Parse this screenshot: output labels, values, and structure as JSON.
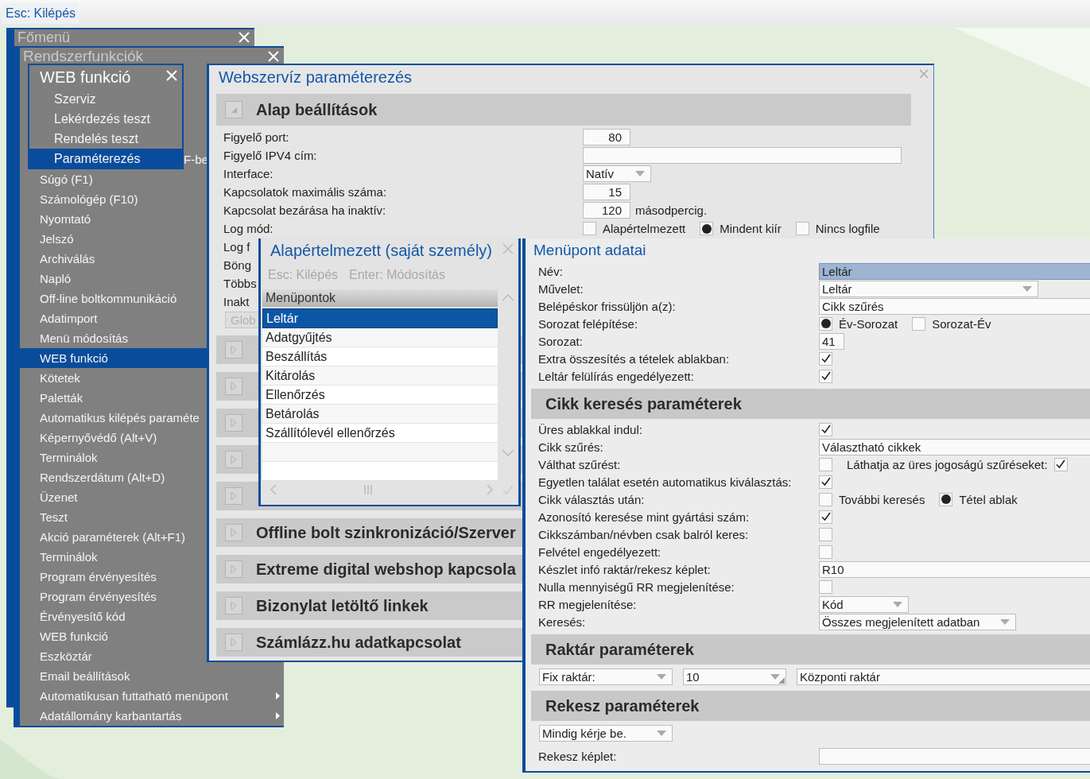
{
  "top_bar": {
    "hint": "Esc: Kilépés"
  },
  "main_menu": {
    "title": "Főmenü"
  },
  "system_functions": {
    "title": "Rendszerfunkciók",
    "items": [
      {
        "label": "F-be",
        "kind": "cut",
        "selected": false,
        "submenu": false
      },
      {
        "label": "Súgó (F1)",
        "kind": "item",
        "selected": false,
        "submenu": false
      },
      {
        "label": "Számológép (F10)",
        "kind": "item",
        "selected": false,
        "submenu": false
      },
      {
        "label": "Nyomtató",
        "kind": "item",
        "selected": false,
        "submenu": false
      },
      {
        "label": "Jelszó",
        "kind": "item",
        "selected": false,
        "submenu": false
      },
      {
        "label": "Archiválás",
        "kind": "item",
        "selected": false,
        "submenu": false
      },
      {
        "label": "Napló",
        "kind": "item",
        "selected": false,
        "submenu": false
      },
      {
        "label": "Off-line boltkommunikáció",
        "kind": "item",
        "selected": false,
        "submenu": false
      },
      {
        "label": "Adatimport",
        "kind": "item",
        "selected": false,
        "submenu": false
      },
      {
        "label": "Menü módosítás",
        "kind": "item",
        "selected": false,
        "submenu": false
      },
      {
        "label": "WEB funkció",
        "kind": "item",
        "selected": true,
        "submenu": false
      },
      {
        "label": "Kötetek",
        "kind": "item",
        "selected": false,
        "submenu": false
      },
      {
        "label": "Paletták",
        "kind": "item",
        "selected": false,
        "submenu": false
      },
      {
        "label": "Automatikus kilépés paraméte",
        "kind": "item",
        "selected": false,
        "submenu": false
      },
      {
        "label": "Képernyővédő (Alt+V)",
        "kind": "item",
        "selected": false,
        "submenu": false
      },
      {
        "label": "Terminálok",
        "kind": "item",
        "selected": false,
        "submenu": false
      },
      {
        "label": "Rendszerdátum (Alt+D)",
        "kind": "item",
        "selected": false,
        "submenu": false
      },
      {
        "label": "Üzenet",
        "kind": "item",
        "selected": false,
        "submenu": false
      },
      {
        "label": "Teszt",
        "kind": "item",
        "selected": false,
        "submenu": false
      },
      {
        "label": "Akció paraméterek (Alt+F1)",
        "kind": "item",
        "selected": false,
        "submenu": false
      },
      {
        "label": "Terminálok",
        "kind": "item",
        "selected": false,
        "submenu": false
      },
      {
        "label": "Program érvényesítés",
        "kind": "item",
        "selected": false,
        "submenu": false
      },
      {
        "label": "Program érvényesítés",
        "kind": "item",
        "selected": false,
        "submenu": false
      },
      {
        "label": "Érvényesítő kód",
        "kind": "item",
        "selected": false,
        "submenu": false
      },
      {
        "label": "WEB funkció",
        "kind": "item",
        "selected": false,
        "submenu": false
      },
      {
        "label": "Eszköztár",
        "kind": "item",
        "selected": false,
        "submenu": false
      },
      {
        "label": "Email beállítások",
        "kind": "item",
        "selected": false,
        "submenu": false
      },
      {
        "label": "Automatikusan futtatható menüpont",
        "kind": "item",
        "selected": false,
        "submenu": true
      },
      {
        "label": "Adatállomány karbantartás",
        "kind": "item",
        "selected": false,
        "submenu": true
      }
    ]
  },
  "web_functions": {
    "title": "WEB funkció",
    "items": [
      {
        "label": "Szerviz",
        "selected": false
      },
      {
        "label": "Lekérdezés teszt",
        "selected": false
      },
      {
        "label": "Rendelés teszt",
        "selected": false
      },
      {
        "label": "Paraméterezés",
        "selected": true
      }
    ]
  },
  "webservice": {
    "title": "Webszervíz paraméterezés",
    "sections": [
      {
        "title": "Alap beállítások",
        "expanded": true,
        "rows": [
          {
            "label": "Figyelő port:",
            "kind": "number",
            "value": "80"
          },
          {
            "label": "Figyelő IPV4 cím:",
            "kind": "text"
          },
          {
            "label": "Interface:",
            "kind": "short_dropdown",
            "value": "Natív"
          },
          {
            "label": "Kapcsolatok maximális száma:",
            "kind": "number",
            "value": "15"
          },
          {
            "label": "Kapcsolat bezárása ha inaktív:",
            "kind": "number_unit",
            "value": "120",
            "unit": "másodpercig."
          },
          {
            "label": "Log mód:",
            "kind": "options",
            "options": [
              {
                "label": "Alapértelmezett",
                "kind": "check",
                "checked": false
              },
              {
                "label": "Mindent kiír",
                "kind": "radio",
                "checked": true
              },
              {
                "label": "Nincs logfile",
                "kind": "check",
                "checked": false
              }
            ]
          },
          {
            "label": "Log f",
            "kind": "label_only"
          },
          {
            "label": "Böng",
            "kind": "label_only"
          },
          {
            "label": "Többs",
            "kind": "label_only"
          },
          {
            "label": "Inakt",
            "kind": "label_only"
          },
          {
            "kind": "button",
            "value": "Glob"
          }
        ]
      },
      {
        "expanded": false
      },
      {
        "expanded": false
      },
      {
        "expanded": false
      },
      {
        "expanded": false
      },
      {
        "expanded": false
      },
      {
        "title": "Offline bolt szinkronizáció/Szerver",
        "expanded": false
      },
      {
        "title": "Extreme digital webshop kapcsola",
        "expanded": false
      },
      {
        "title": "Bizonylat letöltő linkek",
        "expanded": false
      },
      {
        "title": "Számlázz.hu adatkapcsolat",
        "expanded": false
      }
    ]
  },
  "defaults_window": {
    "title": "Alapértelmezett (saját személy)",
    "hints": [
      "Esc: Kilépés",
      "Enter: Módosítás"
    ],
    "list_header": "Menüpontok",
    "items": [
      {
        "label": "Leltár",
        "selected": true
      },
      {
        "label": "Adatgyűjtés",
        "selected": false
      },
      {
        "label": "Beszállítás",
        "selected": false
      },
      {
        "label": "Kitárolás",
        "selected": false
      },
      {
        "label": "Ellenőrzés",
        "selected": false
      },
      {
        "label": "Betárolás",
        "selected": false
      },
      {
        "label": "Szállítólevél ellenőrzés",
        "selected": false
      }
    ]
  },
  "menu_item_data": {
    "title": "Menüpont adatai",
    "sections": [
      {
        "rows": [
          {
            "label": "Név:",
            "kind": "text",
            "value": "Leltár",
            "focused": true
          },
          {
            "label": "Művelet:",
            "kind": "long_dropdown",
            "value": "Leltár"
          },
          {
            "label": "Belépéskor frissüljön a(z):",
            "kind": "text",
            "value": "Cikk szűrés"
          },
          {
            "label": "Sorozat felépítése:",
            "kind": "options",
            "options": [
              {
                "label": "Év-Sorozat",
                "kind": "radio",
                "checked": true
              },
              {
                "label": "Sorozat-Év",
                "kind": "check",
                "checked": false
              }
            ]
          },
          {
            "label": "Sorozat:",
            "kind": "small_number",
            "value": "41"
          },
          {
            "label": "Extra összesítés a tételek ablakban:",
            "kind": "check",
            "checked": true
          },
          {
            "label": "Leltár felülírás engedélyezett:",
            "kind": "check",
            "checked": true
          }
        ]
      },
      {
        "title": "Cikk keresés paraméterek",
        "rows": [
          {
            "label": "Üres ablakkal indul:",
            "kind": "check",
            "checked": true
          },
          {
            "label": "Cikk szűrés:",
            "kind": "text",
            "value": "Választható cikkek"
          },
          {
            "label": "Válthat szűrést:",
            "kind": "options",
            "options": [
              {
                "kind": "check",
                "checked": false
              },
              {
                "label": "Láthatja az üres jogoságú szűréseket:",
                "kind": "label_first_check",
                "checked": true
              }
            ]
          },
          {
            "label": "Egyetlen találat esetén automatikus kiválasztás:",
            "kind": "check",
            "checked": true
          },
          {
            "label": "Cikk választás után:",
            "kind": "options",
            "options": [
              {
                "label": "További keresés",
                "kind": "check",
                "checked": false
              },
              {
                "label": "Tétel ablak",
                "kind": "radio",
                "checked": true
              }
            ]
          },
          {
            "label": "Azonosító keresése mint gyártási szám:",
            "kind": "check",
            "checked": true
          },
          {
            "label": "Cikkszámban/névben csak balról keres:",
            "kind": "check",
            "checked": false
          },
          {
            "label": "Felvétel engedélyezett:",
            "kind": "check",
            "checked": false
          },
          {
            "label": "Készlet infó raktár/rekesz képlet:",
            "kind": "text",
            "value": "R10"
          },
          {
            "label": "Nulla mennyiségű RR megjelenítése:",
            "kind": "check",
            "checked": false
          },
          {
            "label": "RR megjelenítése:",
            "kind": "dropdown",
            "value": "Kód"
          },
          {
            "label": "Keresés:",
            "kind": "medium_dropdown",
            "value": "Összes megjelenített adatban"
          }
        ]
      },
      {
        "title": "Raktár paraméterek",
        "controls": [
          {
            "kind": "wide_dropdown",
            "value": "Fix raktár:"
          },
          {
            "kind": "resizable_dropdown",
            "value": "10"
          },
          {
            "kind": "text",
            "value": "Központi raktár"
          }
        ]
      },
      {
        "title": "Rekesz paraméterek",
        "controls": [
          {
            "kind": "wide_dropdown",
            "value": "Mindig kérje be."
          }
        ],
        "rows": [
          {
            "label": "Rekesz képlet:",
            "kind": "text"
          }
        ]
      }
    ]
  }
}
